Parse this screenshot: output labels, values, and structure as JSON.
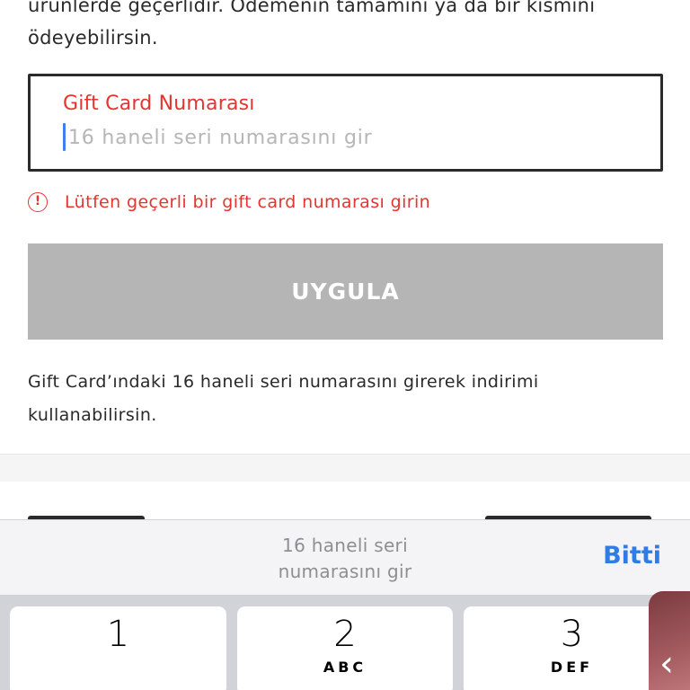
{
  "intro": {
    "line1": "ürünlerde geçerlidir. Ödemenin tamamını ya da bir kısmını",
    "line2": "ödeyebilirsin."
  },
  "gift_card_field": {
    "label": "Gift Card Numarası",
    "value": "",
    "placeholder": "16 haneli seri numarasını gir"
  },
  "error": {
    "icon": "alert-circle-icon",
    "icon_glyph": "!",
    "message": "Lütfen geçerli bir gift card numarası girin"
  },
  "apply_button": {
    "label": "UYGULA"
  },
  "info": {
    "line1": "Gift Card’ındaki 16 haneli seri numarasını girerek indirimi",
    "line2": "kullanabilirsin."
  },
  "keyboard_toolbar": {
    "hint_line1": "16 haneli seri",
    "hint_line2": "numarasını gir",
    "done_label": "Bitti"
  },
  "keypad": {
    "keys": [
      {
        "digit": "1",
        "letters": ""
      },
      {
        "digit": "2",
        "letters": "ABC"
      },
      {
        "digit": "3",
        "letters": "DEF"
      }
    ]
  },
  "side_tab": {
    "icon": "chevron-left-icon",
    "glyph": "‹"
  },
  "colors": {
    "error": "#e8342f",
    "accent": "#2f7ce6",
    "disabled_button": "#b5b5b5",
    "caret": "#3f7df5"
  }
}
